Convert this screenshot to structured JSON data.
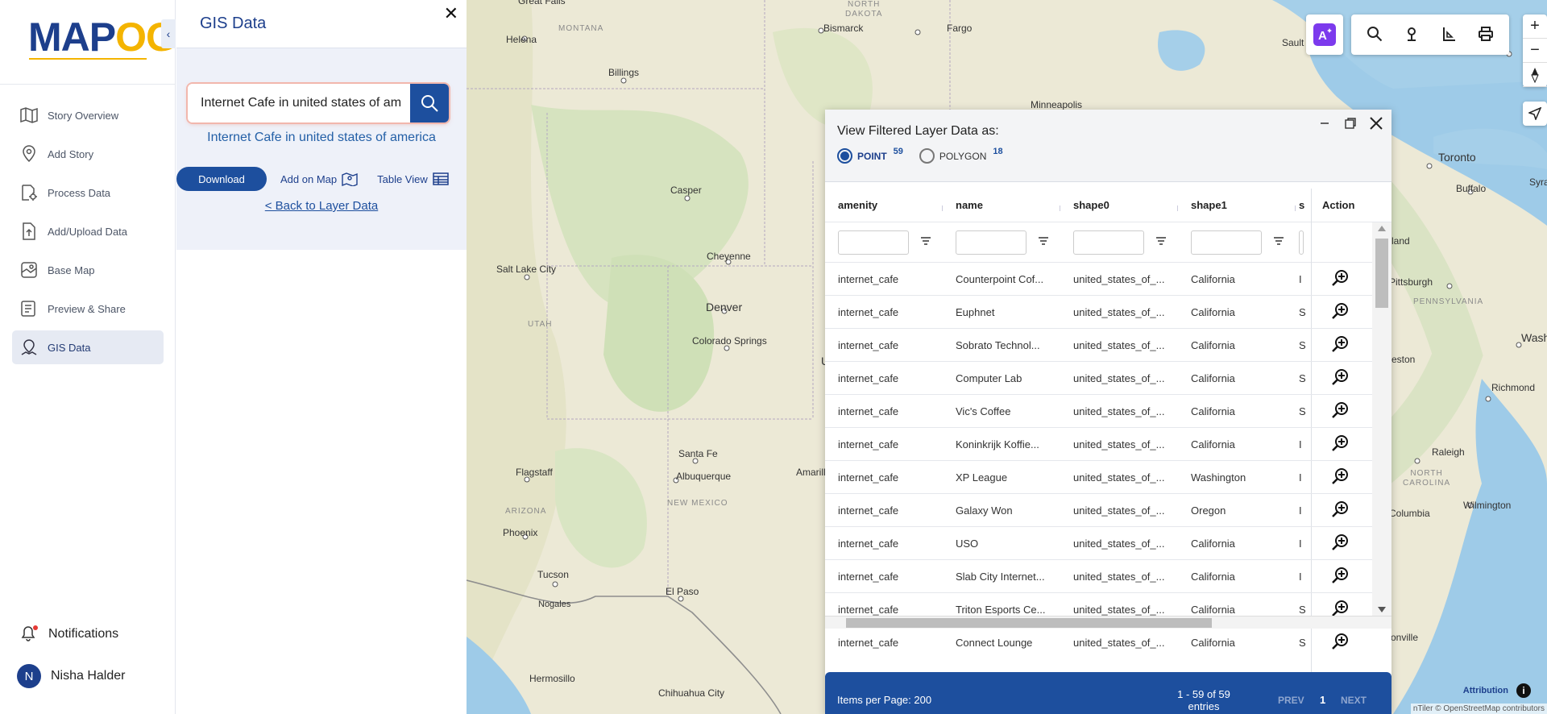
{
  "sidebar": {
    "logo_part1": "MAP",
    "logo_part2": "OG",
    "items": [
      {
        "label": "Story Overview",
        "icon": "map-icon"
      },
      {
        "label": "Add Story",
        "icon": "location-pin-icon"
      },
      {
        "label": "Process Data",
        "icon": "process-data-icon"
      },
      {
        "label": "Add/Upload Data",
        "icon": "upload-file-icon"
      },
      {
        "label": "Base Map",
        "icon": "base-map-icon"
      },
      {
        "label": "Preview & Share",
        "icon": "preview-share-icon"
      },
      {
        "label": "GIS Data",
        "icon": "gis-data-icon",
        "active": true
      }
    ],
    "notifications_label": "Notifications",
    "user": {
      "initial": "N",
      "name": "Nisha Halder"
    }
  },
  "panel": {
    "title": "GIS Data",
    "search_value": "Internet Cafe in united states of am",
    "result_title": "Internet Cafe in united states of america",
    "download_label": "Download",
    "add_on_map_label": "Add on Map",
    "table_view_label": "Table View",
    "back_link": "< Back to Layer Data"
  },
  "map": {
    "labels": {
      "great_falls": "Great Falls",
      "montana": "MONTANA",
      "north_dakota": "NORTH\nDAKOTA",
      "bismarck": "Bismarck",
      "fargo": "Fargo",
      "helena": "Helena",
      "billings": "Billings",
      "minneapolis": "Minneapolis",
      "sault": "Sault",
      "toronto": "Toronto",
      "buffalo": "Buffalo",
      "syracuse": "Syra",
      "casper": "Casper",
      "salt_lake_city": "Salt Lake City",
      "cheyenne": "Cheyenne",
      "denver": "Denver",
      "colorado_springs": "Colorado Springs",
      "utah": "UTAH",
      "pittsburgh": "Pittsburgh",
      "pennsylvania": "PENNSYLVANIA",
      "washington": "Washington",
      "richmond": "Richmond",
      "raleigh": "Raleigh",
      "north_carolina": "NORTH\nCAROLINA",
      "columbia": "Columbia",
      "wilmington": "Wilmington",
      "land": "land",
      "reston": "eston",
      "santa_fe": "Santa Fe",
      "albuquerque": "Albuquerque",
      "flagstaff": "Flagstaff",
      "arizona": "ARIZONA",
      "new_mexico": "NEW MEXICO",
      "amarillo": "Amarill",
      "phoenix": "Phoenix",
      "tucson": "Tucson",
      "nogales": "Nogales",
      "el_paso": "El Paso",
      "hermosillo": "Hermosillo",
      "chihuahua": "Chihuahua City",
      "onville": "onville",
      "u_label": "U"
    },
    "attribution": "Attribution",
    "copyright": "nTiler © OpenStreetMap contributors",
    "zoom_in": "+",
    "zoom_out": "−"
  },
  "dialog": {
    "title": "View Filtered Layer Data as:",
    "point_label": "POINT",
    "point_count": "59",
    "polygon_label": "POLYGON",
    "polygon_count": "18",
    "columns": [
      "amenity",
      "name",
      "shape0",
      "shape1",
      "s",
      "Action"
    ],
    "rows": [
      {
        "amenity": "internet_cafe",
        "name": "Counterpoint Cof...",
        "shape0": "united_states_of_...",
        "shape1": "California",
        "s": "I"
      },
      {
        "amenity": "internet_cafe",
        "name": "Euphnet",
        "shape0": "united_states_of_...",
        "shape1": "California",
        "s": "S"
      },
      {
        "amenity": "internet_cafe",
        "name": "Sobrato Technol...",
        "shape0": "united_states_of_...",
        "shape1": "California",
        "s": "S"
      },
      {
        "amenity": "internet_cafe",
        "name": "Computer Lab",
        "shape0": "united_states_of_...",
        "shape1": "California",
        "s": "S"
      },
      {
        "amenity": "internet_cafe",
        "name": "Vic's Coffee",
        "shape0": "united_states_of_...",
        "shape1": "California",
        "s": "S"
      },
      {
        "amenity": "internet_cafe",
        "name": "Koninkrijk Koffie...",
        "shape0": "united_states_of_...",
        "shape1": "California",
        "s": "I"
      },
      {
        "amenity": "internet_cafe",
        "name": "XP League",
        "shape0": "united_states_of_...",
        "shape1": "Washington",
        "s": "I"
      },
      {
        "amenity": "internet_cafe",
        "name": "Galaxy Won",
        "shape0": "united_states_of_...",
        "shape1": "Oregon",
        "s": "I"
      },
      {
        "amenity": "internet_cafe",
        "name": "USO",
        "shape0": "united_states_of_...",
        "shape1": "California",
        "s": "I"
      },
      {
        "amenity": "internet_cafe",
        "name": "Slab City Internet...",
        "shape0": "united_states_of_...",
        "shape1": "California",
        "s": "I"
      },
      {
        "amenity": "internet_cafe",
        "name": "Triton Esports Ce...",
        "shape0": "united_states_of_...",
        "shape1": "California",
        "s": "S"
      },
      {
        "amenity": "internet_cafe",
        "name": "Connect Lounge",
        "shape0": "united_states_of_...",
        "shape1": "California",
        "s": "S"
      }
    ],
    "items_per_page": "Items per Page: 200",
    "range": "1 - 59 of 59 entries",
    "prev": "PREV",
    "page": "1",
    "next": "NEXT"
  },
  "colors": {
    "primary": "#1d4f9e",
    "accent": "#f4b400"
  }
}
